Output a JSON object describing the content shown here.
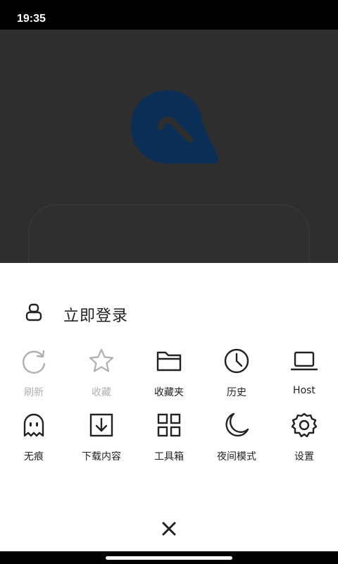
{
  "status_bar": {
    "time": "19:35"
  },
  "menu": {
    "login_label": "立即登录",
    "rows": [
      [
        {
          "label": "刷新",
          "icon": "refresh-icon",
          "enabled": false
        },
        {
          "label": "收藏",
          "icon": "star-icon",
          "enabled": false
        },
        {
          "label": "收藏夹",
          "icon": "folder-icon",
          "enabled": true
        },
        {
          "label": "历史",
          "icon": "clock-icon",
          "enabled": true
        },
        {
          "label": "Host",
          "icon": "laptop-icon",
          "enabled": true
        }
      ],
      [
        {
          "label": "无痕",
          "icon": "ghost-icon",
          "enabled": true
        },
        {
          "label": "下载内容",
          "icon": "download-icon",
          "enabled": true
        },
        {
          "label": "工具箱",
          "icon": "grid-icon",
          "enabled": true
        },
        {
          "label": "夜间模式",
          "icon": "moon-icon",
          "enabled": true
        },
        {
          "label": "设置",
          "icon": "gear-icon",
          "enabled": true
        }
      ]
    ]
  },
  "colors": {
    "backdrop": "#2e2e2e",
    "logo": "#0b2e57",
    "sheet": "#ffffff",
    "icon": "#222222",
    "disabled": "#b0b0b0"
  }
}
